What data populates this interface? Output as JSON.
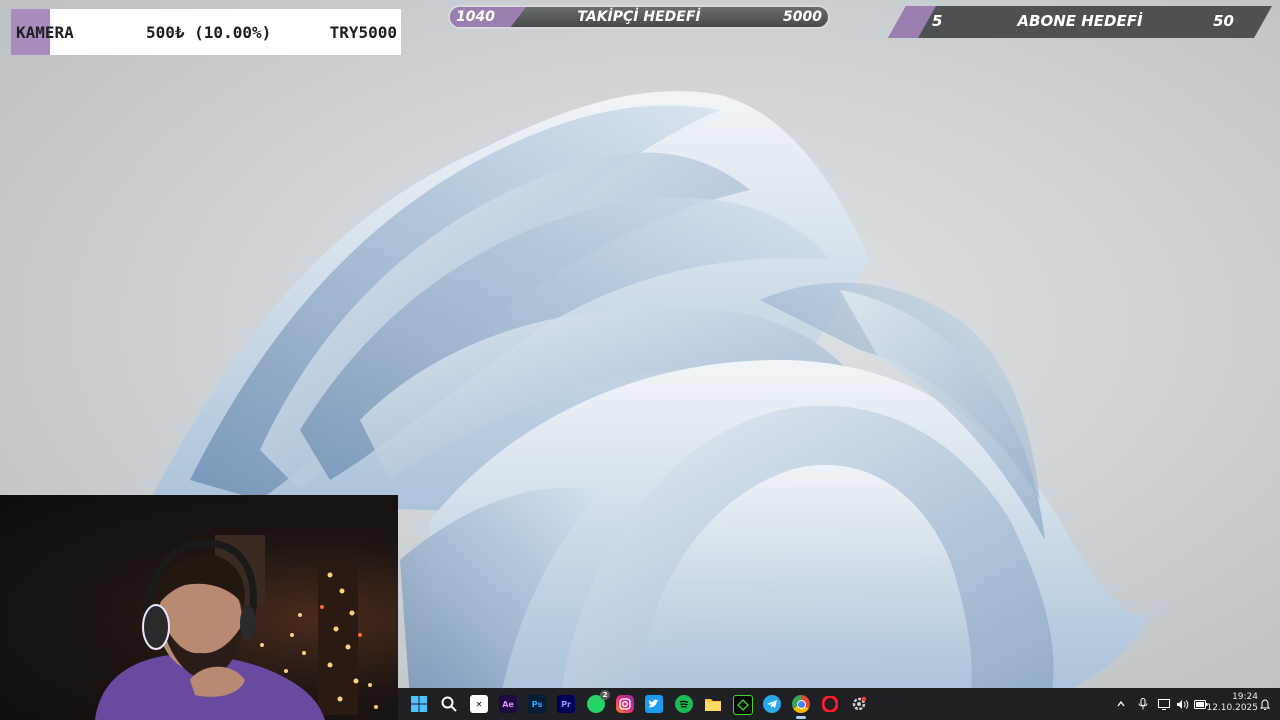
{
  "camera_goal": {
    "label": "KAMERA",
    "progress_text": "500₺ (10.00%)",
    "target_text": "TRY5000",
    "progress_fraction": 0.1,
    "fill_color": "#a98bbf"
  },
  "follower_goal": {
    "current": "1040",
    "title": "TAKİPÇİ HEDEFİ",
    "target": "5000",
    "progress_fraction": 0.208
  },
  "subscriber_goal": {
    "current": "5",
    "title": "ABONE HEDEFİ",
    "target": "50",
    "progress_fraction": 0.1
  },
  "taskbar": {
    "icons": [
      "windows-start-icon",
      "search-icon",
      "capcut-icon",
      "after-effects-icon",
      "photoshop-icon",
      "premiere-icon",
      "whatsapp-icon",
      "instagram-icon",
      "twitter-icon",
      "spotify-icon",
      "file-explorer-icon",
      "razer-icon",
      "telegram-icon",
      "chrome-icon",
      "opera-icon",
      "settings-icon"
    ],
    "labels": {
      "ae": "Ae",
      "ps": "Ps",
      "pr": "Pr",
      "whatsapp_badge": "2"
    },
    "clock_time": "19:24",
    "clock_date": "12.10.2025"
  },
  "accent_color": "#9a7fb0"
}
